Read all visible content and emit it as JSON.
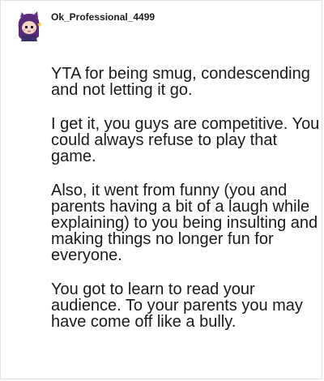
{
  "comment": {
    "username": "Ok_Professional_4499",
    "avatar_icon": "snoo-avatar-icon",
    "paragraphs": [
      "YTA for being smug, condescending and not letting it go.",
      "I get it, you guys are competitive. You could always refuse to play that game.",
      "Also, it went from funny (you and parents having a bit of a laugh while explaining) to you being insulting and making things no longer fun for everyone.",
      "You got to learn to read your audience. To your parents you may have come off like a bully."
    ]
  },
  "colors": {
    "text": "#1a1a1b",
    "border": "#e3e3e3",
    "avatar_hair": "#5b2a7a",
    "avatar_skin": "#f3d7c6"
  }
}
